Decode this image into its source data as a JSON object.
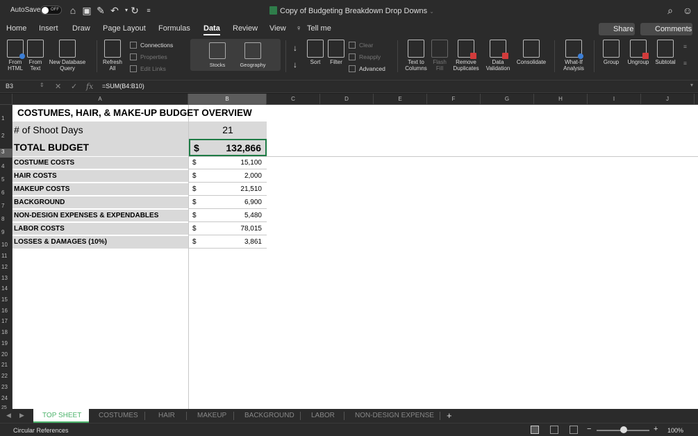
{
  "titlebar": {
    "autosave_label": "AutoSave",
    "autosave_state": "OFF",
    "document_title": "Copy of Budgeting Breakdown Drop Downs"
  },
  "tabs": [
    "Home",
    "Insert",
    "Draw",
    "Page Layout",
    "Formulas",
    "Data",
    "Review",
    "View"
  ],
  "tell_me": "Tell me",
  "share_label": "Share",
  "comments_label": "Comments",
  "ribbon": {
    "from_html": [
      "From",
      "HTML"
    ],
    "from_text": [
      "From",
      "Text"
    ],
    "new_db_query": [
      "New Database",
      "Query"
    ],
    "refresh_all": [
      "Refresh",
      "All"
    ],
    "connections": "Connections",
    "properties": "Properties",
    "edit_links": "Edit Links",
    "stocks": "Stocks",
    "geography": "Geography",
    "sort": "Sort",
    "filter": "Filter",
    "clear": "Clear",
    "reapply": "Reapply",
    "advanced": "Advanced",
    "text_to_columns": [
      "Text to",
      "Columns"
    ],
    "flash_fill": [
      "Flash",
      "Fill"
    ],
    "remove_duplicates": [
      "Remove",
      "Duplicates"
    ],
    "data_validation": [
      "Data",
      "Validation"
    ],
    "consolidate": "Consolidate",
    "what_if": [
      "What-If",
      "Analysis"
    ],
    "group": "Group",
    "ungroup": "Ungroup",
    "subtotal": "Subtotal"
  },
  "formula_bar": {
    "name_box": "B3",
    "fx": "fx",
    "formula": "=SUM(B4:B10)"
  },
  "columns": [
    "A",
    "B",
    "C",
    "D",
    "E",
    "F",
    "G",
    "H",
    "I",
    "J"
  ],
  "rows": [
    "1",
    "2",
    "3",
    "4",
    "5",
    "6",
    "7",
    "8",
    "9",
    "10",
    "11",
    "12",
    "13",
    "14",
    "15",
    "16",
    "17",
    "18",
    "19",
    "20",
    "21",
    "22",
    "23",
    "24",
    "25"
  ],
  "sheet": {
    "title": "COSTUMES, HAIR, & MAKE-UP BUDGET OVERVIEW",
    "shoot_days_label": "# of Shoot Days",
    "shoot_days_value": "21",
    "total_label": "TOTAL BUDGET",
    "total_currency": "$",
    "total_value": "132,866",
    "currency": "$",
    "lines": [
      {
        "label": "COSTUME COSTS",
        "value": "15,100"
      },
      {
        "label": "HAIR COSTS",
        "value": "2,000"
      },
      {
        "label": "MAKEUP COSTS",
        "value": "21,510"
      },
      {
        "label": "BACKGROUND",
        "value": "6,900"
      },
      {
        "label": "NON-DESIGN EXPENSES & EXPENDABLES",
        "value": "5,480"
      },
      {
        "label": "LABOR COSTS",
        "value": "78,015"
      },
      {
        "label": "LOSSES & DAMAGES (10%)",
        "value": "3,861"
      }
    ]
  },
  "sheet_tabs": [
    "TOP SHEET",
    "COSTUMES",
    "HAIR",
    "MAKEUP",
    "BACKGROUND",
    "LABOR",
    "NON-DESIGN EXPENSE"
  ],
  "add_sheet": "+",
  "status": {
    "text": "Circular References",
    "zoom": "100%",
    "zoom_minus": "−",
    "zoom_plus": "+"
  },
  "colors": {
    "accent_green": "#4bb36a",
    "ribbon_bg": "#2b2b2b",
    "gray_cell": "#d9d9d9"
  }
}
